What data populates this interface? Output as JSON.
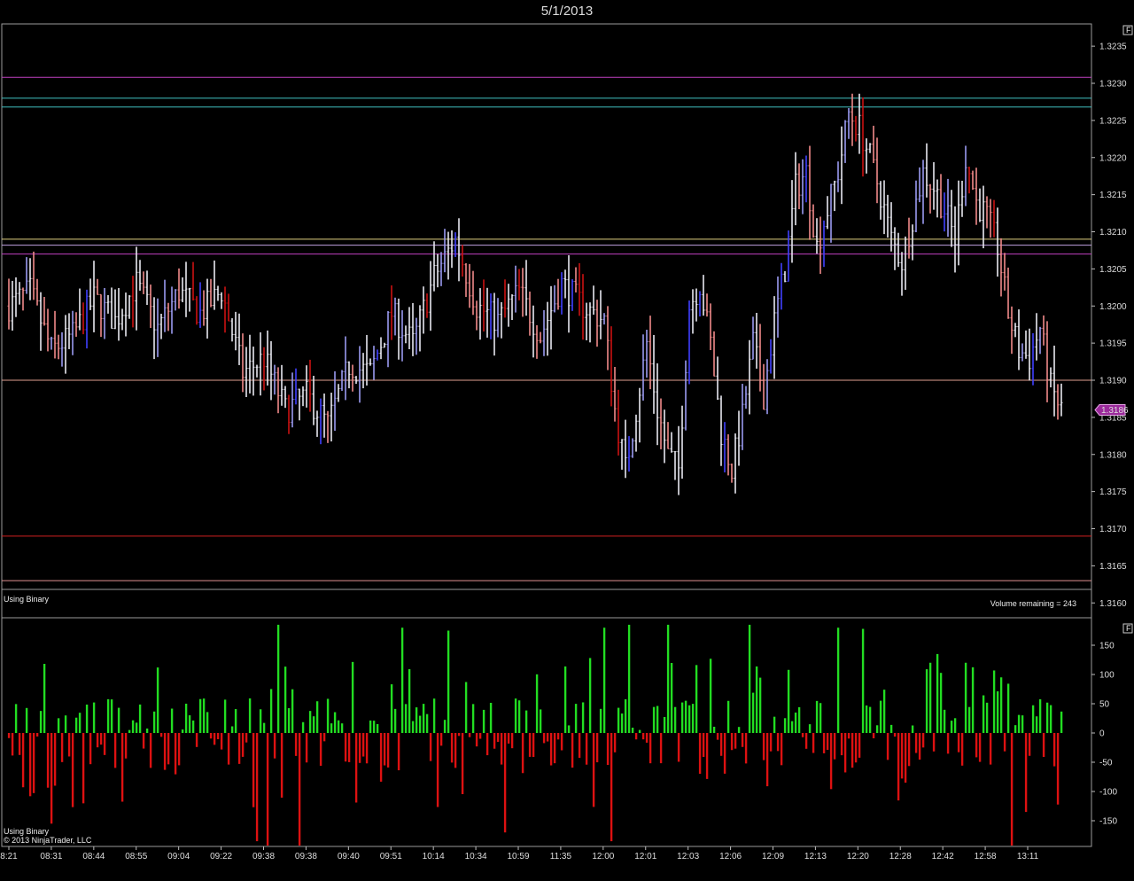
{
  "window": {
    "title": "5/1/2013"
  },
  "price_panel": {
    "indicator_label": "Using Binary",
    "volume_remaining": "Volume remaining = 243",
    "current_price": "1.3186",
    "button_label": "F"
  },
  "volume_panel": {
    "indicator_label": "Using Binary",
    "copyright": "© 2013 NinjaTrader, LLC",
    "button_label": "F"
  },
  "colors": {
    "background": "#000000",
    "up": "#4040ff",
    "down": "#cc1111",
    "neutral": "#e8e8f0",
    "volume_positive": "#22dd22",
    "volume_negative": "#dd1111",
    "current_price_badge": "#9b2a9b"
  },
  "chart_data": [
    {
      "type": "ohlc",
      "title": "",
      "ylim": [
        1.3158,
        1.3238
      ],
      "y_ticks": [
        "1.3235",
        "1.3230",
        "1.3225",
        "1.3220",
        "1.3215",
        "1.3210",
        "1.3205",
        "1.3200",
        "1.3195",
        "1.3190",
        "1.3185",
        "1.3180",
        "1.3175",
        "1.3170",
        "1.3165",
        "1.3160"
      ],
      "x_ticks": [
        "8:21",
        "08:31",
        "08:44",
        "08:55",
        "09:04",
        "09:22",
        "09:38",
        "09:38",
        "09:40",
        "09:51",
        "10:14",
        "10:34",
        "10:59",
        "11:35",
        "12:00",
        "12:01",
        "12:03",
        "12:06",
        "12:09",
        "12:13",
        "12:20",
        "12:28",
        "12:42",
        "12:58",
        "13:11"
      ],
      "horizontal_lines": [
        {
          "price": 1.32308,
          "color": "#c040c0"
        },
        {
          "price": 1.3228,
          "color": "#40c0c0"
        },
        {
          "price": 1.32268,
          "color": "#40c0c0"
        },
        {
          "price": 1.3209,
          "color": "#e0d080"
        },
        {
          "price": 1.32082,
          "color": "#c0a0e0"
        },
        {
          "price": 1.3207,
          "color": "#c040c0"
        },
        {
          "price": 1.319,
          "color": "#e0a090"
        },
        {
          "price": 1.3169,
          "color": "#d02020"
        },
        {
          "price": 1.3163,
          "color": "#e09090"
        }
      ],
      "anchors": [
        [
          0,
          1.32
        ],
        [
          6,
          1.3202
        ],
        [
          12,
          1.3194
        ],
        [
          18,
          1.3196
        ],
        [
          24,
          1.3201
        ],
        [
          30,
          1.3198
        ],
        [
          36,
          1.3203
        ],
        [
          42,
          1.3197
        ],
        [
          48,
          1.3202
        ],
        [
          54,
          1.3199
        ],
        [
          60,
          1.3202
        ],
        [
          66,
          1.3191
        ],
        [
          72,
          1.3193
        ],
        [
          78,
          1.3186
        ],
        [
          84,
          1.3188
        ],
        [
          90,
          1.3184
        ],
        [
          96,
          1.3192
        ],
        [
          102,
          1.3191
        ],
        [
          108,
          1.3199
        ],
        [
          114,
          1.3195
        ],
        [
          120,
          1.3204
        ],
        [
          126,
          1.3209
        ],
        [
          132,
          1.32
        ],
        [
          138,
          1.3198
        ],
        [
          144,
          1.3202
        ],
        [
          150,
          1.3196
        ],
        [
          156,
          1.3203
        ],
        [
          162,
          1.32
        ],
        [
          168,
          1.3198
        ],
        [
          171,
          1.3186
        ],
        [
          174,
          1.3178
        ],
        [
          177,
          1.3186
        ],
        [
          180,
          1.3195
        ],
        [
          183,
          1.3186
        ],
        [
          186,
          1.318
        ],
        [
          189,
          1.3178
        ],
        [
          192,
          1.32
        ],
        [
          195,
          1.3203
        ],
        [
          198,
          1.3195
        ],
        [
          201,
          1.3183
        ],
        [
          204,
          1.3178
        ],
        [
          207,
          1.3185
        ],
        [
          210,
          1.3195
        ],
        [
          213,
          1.3188
        ],
        [
          216,
          1.3198
        ],
        [
          219,
          1.3205
        ],
        [
          222,
          1.3216
        ],
        [
          225,
          1.3218
        ],
        [
          228,
          1.3208
        ],
        [
          231,
          1.3213
        ],
        [
          234,
          1.3218
        ],
        [
          237,
          1.3226
        ],
        [
          240,
          1.3224
        ],
        [
          243,
          1.322
        ],
        [
          246,
          1.3215
        ],
        [
          249,
          1.3209
        ],
        [
          252,
          1.3206
        ],
        [
          255,
          1.3212
        ],
        [
          258,
          1.3218
        ],
        [
          261,
          1.3216
        ],
        [
          264,
          1.3213
        ],
        [
          267,
          1.3209
        ],
        [
          270,
          1.322
        ],
        [
          273,
          1.3214
        ],
        [
          276,
          1.3212
        ],
        [
          279,
          1.3208
        ],
        [
          282,
          1.3199
        ],
        [
          285,
          1.3194
        ],
        [
          288,
          1.3193
        ],
        [
          291,
          1.3197
        ],
        [
          294,
          1.3189
        ],
        [
          297,
          1.3186
        ]
      ],
      "current_price": 1.3186
    },
    {
      "type": "bar",
      "title": "",
      "ylim": [
        -190,
        190
      ],
      "y_ticks": [
        150,
        100,
        50,
        0,
        -50,
        -100,
        -150
      ],
      "spike_bars": [
        {
          "index": 12,
          "value": -155
        },
        {
          "index": 70,
          "value": -185
        },
        {
          "index": 73,
          "value": -195
        },
        {
          "index": 76,
          "value": 185
        },
        {
          "index": 82,
          "value": -200
        },
        {
          "index": 111,
          "value": 180
        },
        {
          "index": 124,
          "value": 175
        },
        {
          "index": 140,
          "value": -170
        },
        {
          "index": 168,
          "value": 180
        },
        {
          "index": 170,
          "value": -185
        },
        {
          "index": 175,
          "value": 185
        },
        {
          "index": 186,
          "value": 185
        },
        {
          "index": 209,
          "value": 185
        },
        {
          "index": 234,
          "value": 180
        },
        {
          "index": 241,
          "value": 178
        },
        {
          "index": 262,
          "value": 135
        },
        {
          "index": 283,
          "value": -195
        },
        {
          "index": 287,
          "value": -135
        }
      ]
    }
  ]
}
